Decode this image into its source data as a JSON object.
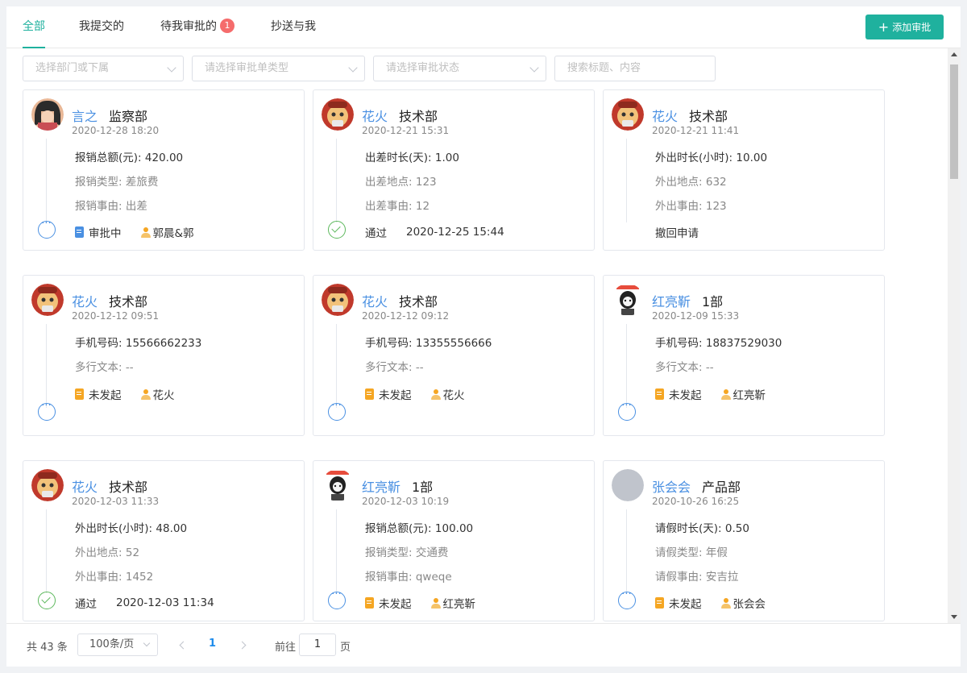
{
  "tabs": [
    {
      "label": "全部",
      "active": true
    },
    {
      "label": "我提交的",
      "active": false
    },
    {
      "label": "待我审批的",
      "active": false,
      "badge": "1"
    },
    {
      "label": "抄送与我",
      "active": false
    }
  ],
  "add_button": {
    "icon": "plus-icon",
    "label": "添加审批"
  },
  "filters": {
    "department": "选择部门或下属",
    "type": "请选择审批单类型",
    "status": "请选择审批状态",
    "search": "搜索标题、内容"
  },
  "cards": [
    {
      "name": "言之",
      "dept": "监察部",
      "date": "2020-12-28 18:20",
      "avatar": "girl-avatar",
      "fields": [
        {
          "label": "报销总额(元):",
          "value": "420.00"
        },
        {
          "label": "报销类型:",
          "value": "差旅费"
        },
        {
          "label": "报销事由:",
          "value": "出差"
        }
      ],
      "status_icon": "more",
      "footer": {
        "state": "审批中",
        "state_icon": "doc-blue",
        "person": "郭晨&郭"
      }
    },
    {
      "name": "花火",
      "dept": "技术部",
      "date": "2020-12-21 15:31",
      "avatar": "cartoon-avatar",
      "fields": [
        {
          "label": "出差时长(天):",
          "value": "1.00"
        },
        {
          "label": "出差地点:",
          "value": "123"
        },
        {
          "label": "出差事由:",
          "value": "12"
        }
      ],
      "status_icon": "ok",
      "footer": {
        "state": "通过",
        "time": "2020-12-25 15:44"
      }
    },
    {
      "name": "花火",
      "dept": "技术部",
      "date": "2020-12-21 11:41",
      "avatar": "cartoon-avatar",
      "fields": [
        {
          "label": "外出时长(小时):",
          "value": "10.00"
        },
        {
          "label": "外出地点:",
          "value": "632"
        },
        {
          "label": "外出事由:",
          "value": "123"
        }
      ],
      "status_icon": "none",
      "footer": {
        "state": "撤回申请"
      }
    },
    {
      "name": "花火",
      "dept": "技术部",
      "date": "2020-12-12 09:51",
      "avatar": "cartoon-avatar",
      "fields": [
        {
          "label": "手机号码:",
          "value": "15566662233"
        },
        {
          "label": "多行文本:",
          "value": "--"
        }
      ],
      "status_icon": "more",
      "footer": {
        "state": "未发起",
        "state_icon": "doc-orange",
        "person": "花火"
      }
    },
    {
      "name": "花火",
      "dept": "技术部",
      "date": "2020-12-12 09:12",
      "avatar": "cartoon-avatar",
      "fields": [
        {
          "label": "手机号码:",
          "value": "13355556666"
        },
        {
          "label": "多行文本:",
          "value": "--"
        }
      ],
      "status_icon": "more",
      "footer": {
        "state": "未发起",
        "state_icon": "doc-orange",
        "person": "花火"
      }
    },
    {
      "name": "红亮靳",
      "dept": "1部",
      "date": "2020-12-09 15:33",
      "avatar": "meme-avatar",
      "fields": [
        {
          "label": "手机号码:",
          "value": "18837529030"
        },
        {
          "label": "多行文本:",
          "value": "--"
        }
      ],
      "status_icon": "more",
      "footer": {
        "state": "未发起",
        "state_icon": "doc-orange",
        "person": "红亮靳"
      }
    },
    {
      "name": "花火",
      "dept": "技术部",
      "date": "2020-12-03 11:33",
      "avatar": "cartoon-avatar",
      "fields": [
        {
          "label": "外出时长(小时):",
          "value": "48.00"
        },
        {
          "label": "外出地点:",
          "value": "52"
        },
        {
          "label": "外出事由:",
          "value": "1452"
        }
      ],
      "status_icon": "ok",
      "footer": {
        "state": "通过",
        "time": "2020-12-03 11:34"
      }
    },
    {
      "name": "红亮靳",
      "dept": "1部",
      "date": "2020-12-03 10:19",
      "avatar": "meme-avatar",
      "fields": [
        {
          "label": "报销总额(元):",
          "value": "100.00"
        },
        {
          "label": "报销类型:",
          "value": "交通费"
        },
        {
          "label": "报销事由:",
          "value": "qweqe"
        }
      ],
      "status_icon": "more",
      "footer": {
        "state": "未发起",
        "state_icon": "doc-orange",
        "person": "红亮靳"
      }
    },
    {
      "name": "张会会",
      "dept": "产品部",
      "date": "2020-10-26 16:25",
      "avatar": "gray-avatar",
      "fields": [
        {
          "label": "请假时长(天):",
          "value": "0.50"
        },
        {
          "label": "请假类型:",
          "value": "年假"
        },
        {
          "label": "请假事由:",
          "value": "安吉拉"
        }
      ],
      "status_icon": "more",
      "footer": {
        "state": "未发起",
        "state_icon": "doc-orange",
        "person": "张会会"
      }
    }
  ],
  "pagination": {
    "total": "共 43 条",
    "page_size": "100条/页",
    "current_page": "1",
    "goto_label": "前往",
    "goto_value": "1",
    "page_label": "页"
  },
  "colors": {
    "accent": "#1fb19e",
    "link": "#4a90e2",
    "badge": "#f56c6c",
    "pending": "#f5a623",
    "ok": "#5cb85c"
  }
}
